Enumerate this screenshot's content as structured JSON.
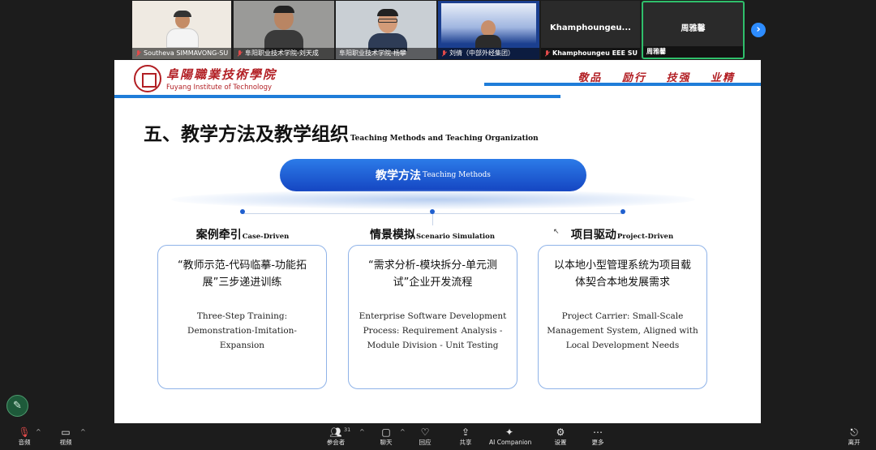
{
  "participants": [
    {
      "name": "Southeva SIMMAVONG-SU",
      "muted": true
    },
    {
      "name": "阜阳职业技术学院-刘天成",
      "muted": true
    },
    {
      "name": "阜阳职业技术学院-杨攀",
      "muted": false
    },
    {
      "name": "刘倩（中部外经集团）",
      "muted": true
    },
    {
      "name": "Khamphoungeu EEE   SU",
      "display": "Khamphoungeu...",
      "muted": true
    },
    {
      "name": "周雅馨",
      "display": "周雅馨",
      "muted": false
    }
  ],
  "slide": {
    "logo_cn": "阜陽職業技術學院",
    "logo_en": "Fuyang Institute of Technology",
    "motto": "敬品 励行 技强 业精",
    "title_cn": "五、教学方法及教学组织",
    "title_en": "Teaching Methods and Teaching Organization",
    "banner_cn": "教学方法",
    "banner_en": "Teaching Methods",
    "columns": [
      {
        "head_cn": "案例牵引",
        "head_en": "Case-Driven",
        "body_cn": "“教师示范-代码临摹-功能拓展”三步递进训练",
        "body_en": "Three-Step Training: Demonstration-Imitation-Expansion"
      },
      {
        "head_cn": "情景模拟",
        "head_en": "Scenario Simulation",
        "body_cn": "“需求分析-模块拆分-单元测试”企业开发流程",
        "body_en": "Enterprise Software Development Process: Requirement Analysis - Module Division - Unit Testing"
      },
      {
        "head_cn": "项目驱动",
        "head_en": "Project-Driven",
        "body_cn": "以本地小型管理系统为项目载体契合本地发展需求",
        "body_en": "Project Carrier: Small-Scale Management System, Aligned with Local Development Needs"
      }
    ]
  },
  "toolbar": {
    "audio": "音频",
    "video": "视频",
    "participants": "参会者",
    "participant_count": "31",
    "chat": "聊天",
    "react": "回应",
    "share": "共享",
    "ai": "AI Companion",
    "settings": "设置",
    "more": "更多",
    "leave": "离开"
  },
  "colors": {
    "accent_blue": "#1f7dd9",
    "brand_red": "#b21f24",
    "active_speaker": "#2fbf6b"
  }
}
